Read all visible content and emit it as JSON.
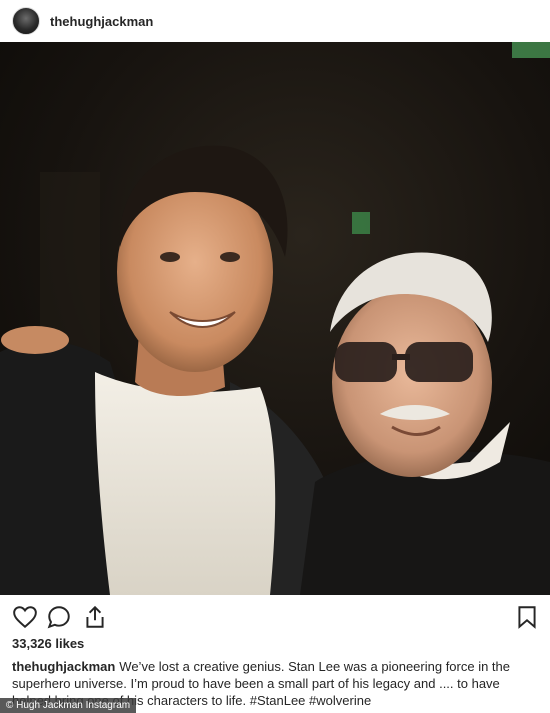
{
  "post": {
    "username": "thehughjackman",
    "likes": "33,326 likes",
    "caption_user": "thehughjackman",
    "caption_text": "We’ve lost a creative genius. Stan Lee was a pioneering force in the superhero universe. I’m proud to have been a small part of his legacy and .... to have helped bring one of his characters to life. #StanLee #wolverine"
  },
  "icons": {
    "like": "heart-icon",
    "comment": "comment-icon",
    "share": "share-icon",
    "save": "bookmark-icon"
  },
  "watermark": "© Hugh Jackman Instagram"
}
